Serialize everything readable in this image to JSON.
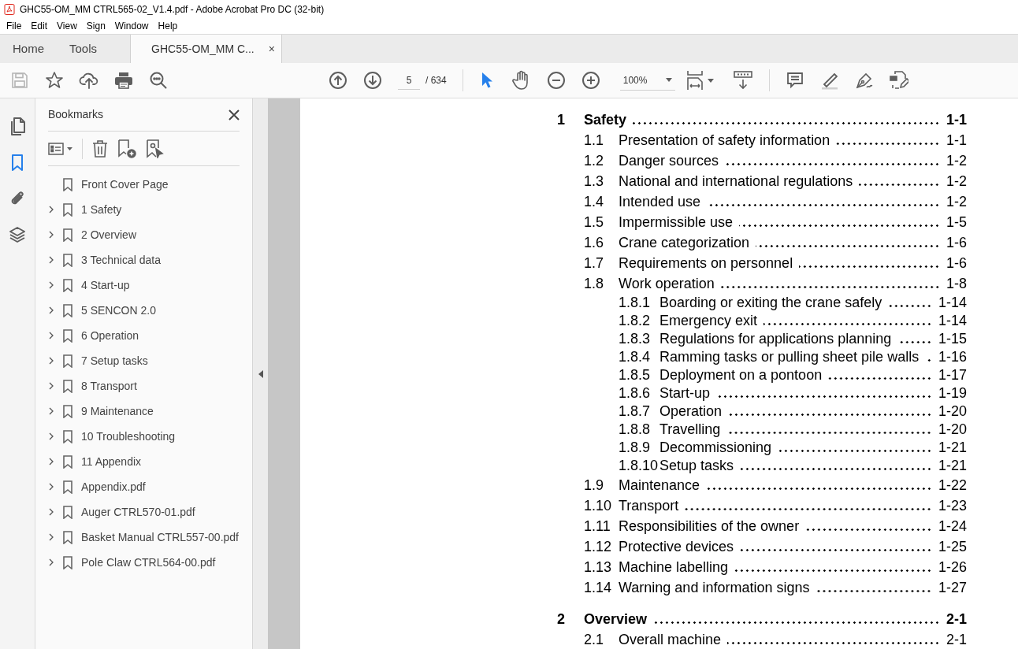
{
  "window": {
    "title": "GHC55-OM_MM CTRL565-02_V1.4.pdf - Adobe Acrobat Pro DC (32-bit)"
  },
  "menu": [
    "File",
    "Edit",
    "View",
    "Sign",
    "Window",
    "Help"
  ],
  "tabs": [
    {
      "label": "Home",
      "selected": false
    },
    {
      "label": "Tools",
      "selected": false
    },
    {
      "label": "GHC55-OM_MM C...",
      "selected": true,
      "close": "×"
    }
  ],
  "toolbar": {
    "page": "5",
    "page_total": "/ 634",
    "zoom": "100%",
    "select_tool_on": true
  },
  "side_rail": [
    {
      "kind": "pages",
      "selected": false
    },
    {
      "kind": "bookmarks",
      "selected": true
    },
    {
      "kind": "attachments",
      "selected": false
    },
    {
      "kind": "layers",
      "selected": false
    }
  ],
  "bookmarks": {
    "title": "Bookmarks",
    "items": [
      {
        "label": "Front Cover Page",
        "expandable": false
      },
      {
        "label": "1 Safety",
        "expandable": true
      },
      {
        "label": "2 Overview",
        "expandable": true
      },
      {
        "label": "3 Technical data",
        "expandable": true
      },
      {
        "label": "4 Start-up",
        "expandable": true
      },
      {
        "label": "5 SENCON 2.0",
        "expandable": true
      },
      {
        "label": "6 Operation",
        "expandable": true
      },
      {
        "label": "7 Setup tasks",
        "expandable": true
      },
      {
        "label": "8 Transport",
        "expandable": true
      },
      {
        "label": "9 Maintenance",
        "expandable": true
      },
      {
        "label": "10 Troubleshooting",
        "expandable": true
      },
      {
        "label": "11 Appendix",
        "expandable": true
      },
      {
        "label": "Appendix.pdf",
        "expandable": true
      },
      {
        "label": "Auger CTRL570-01.pdf",
        "expandable": true
      },
      {
        "label": "Basket Manual CTRL557-00.pdf",
        "expandable": true
      },
      {
        "label": "Pole Claw CTRL564-00.pdf",
        "expandable": true
      }
    ]
  },
  "toc": [
    {
      "number": "1",
      "title": "Safety",
      "page": "1-1",
      "children": [
        {
          "number": "1.1",
          "title": "Presentation of safety information",
          "page": "1-1"
        },
        {
          "number": "1.2",
          "title": "Danger sources",
          "page": "1-2"
        },
        {
          "number": "1.3",
          "title": "National and international regulations",
          "page": "1-2"
        },
        {
          "number": "1.4",
          "title": "Intended use",
          "page": "1-2"
        },
        {
          "number": "1.5",
          "title": "Impermissible use",
          "page": "1-5"
        },
        {
          "number": "1.6",
          "title": "Crane categorization",
          "page": "1-6"
        },
        {
          "number": "1.7",
          "title": "Requirements on personnel",
          "page": "1-6"
        },
        {
          "number": "1.8",
          "title": "Work operation",
          "page": "1-8",
          "children": [
            {
              "number": "1.8.1",
              "title": "Boarding or exiting the crane safely",
              "page": "1-14"
            },
            {
              "number": "1.8.2",
              "title": "Emergency exit",
              "page": "1-14"
            },
            {
              "number": "1.8.3",
              "title": "Regulations for applications planning",
              "page": "1-15"
            },
            {
              "number": "1.8.4",
              "title": "Ramming tasks or pulling sheet pile walls",
              "page": "1-16"
            },
            {
              "number": "1.8.5",
              "title": "Deployment on a pontoon",
              "page": "1-17"
            },
            {
              "number": "1.8.6",
              "title": "Start-up",
              "page": "1-19"
            },
            {
              "number": "1.8.7",
              "title": "Operation",
              "page": "1-20"
            },
            {
              "number": "1.8.8",
              "title": "Travelling",
              "page": "1-20"
            },
            {
              "number": "1.8.9",
              "title": "Decommissioning",
              "page": "1-21"
            },
            {
              "number": "1.8.10",
              "title": "Setup tasks",
              "page": "1-21"
            }
          ]
        },
        {
          "number": "1.9",
          "title": "Maintenance",
          "page": "1-22"
        },
        {
          "number": "1.10",
          "title": "Transport",
          "page": "1-23"
        },
        {
          "number": "1.11",
          "title": "Responsibilities of the owner",
          "page": "1-24"
        },
        {
          "number": "1.12",
          "title": "Protective devices",
          "page": "1-25"
        },
        {
          "number": "1.13",
          "title": "Machine labelling",
          "page": "1-26"
        },
        {
          "number": "1.14",
          "title": "Warning and information signs",
          "page": "1-27"
        }
      ]
    },
    {
      "number": "2",
      "title": "Overview",
      "page": "2-1",
      "children": [
        {
          "number": "2.1",
          "title": "Overall machine",
          "page": "2-1"
        }
      ]
    }
  ]
}
